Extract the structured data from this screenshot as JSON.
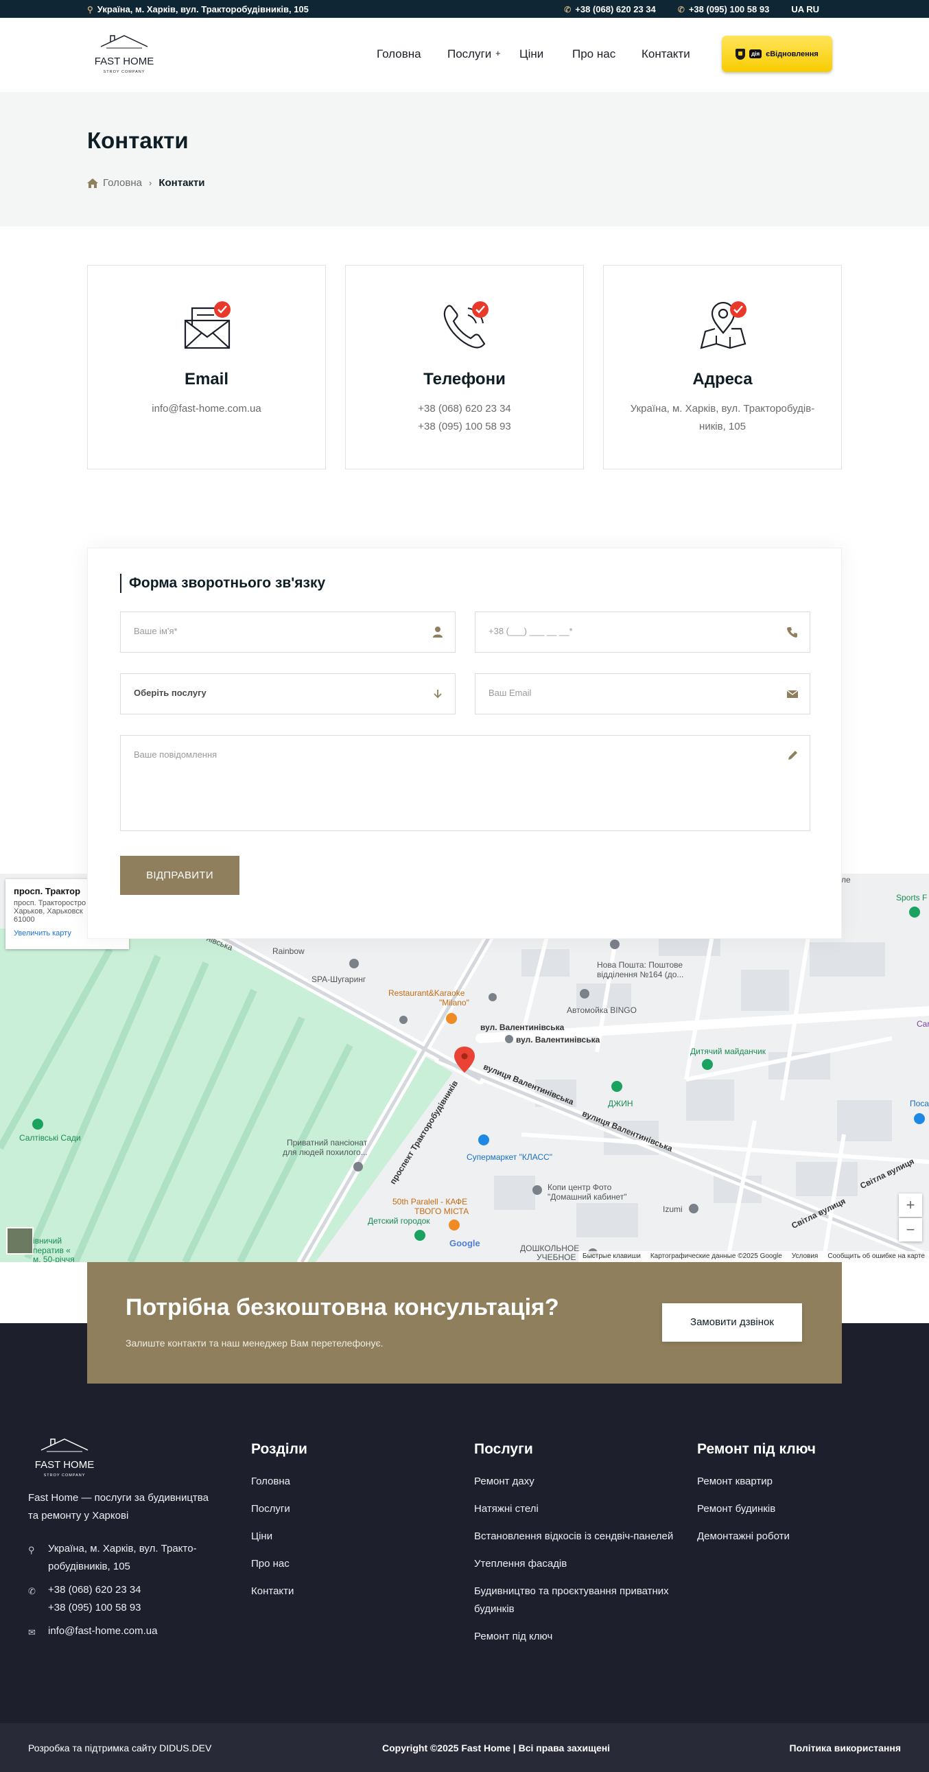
{
  "topbar": {
    "address": "Україна, м. Харків, вул. Тракторобудівників, 105",
    "phone1": "+38 (068) 620 23 34",
    "phone2": "+38 (095) 100 58 93",
    "lang": "UA RU"
  },
  "header": {
    "logo_name": "FAST HOME",
    "logo_sub": "STROY COMPANY",
    "nav": [
      "Головна",
      "Послуги",
      "Ціни",
      "Про нас",
      "Контакти"
    ],
    "nav_plus": "+",
    "diia_badge": "дія",
    "diia_label": "єВідновлення"
  },
  "page": {
    "title": "Контакти",
    "breadcrumb_home": "Головна",
    "breadcrumb_current": "Контакти"
  },
  "cards": [
    {
      "icon": "email-icon",
      "title": "Email",
      "lines": [
        "info@fast-home.com.ua"
      ]
    },
    {
      "icon": "phone-icon",
      "title": "Телефони",
      "lines": [
        "+38 (068) 620 23 34",
        "+38 (095) 100 58 93"
      ]
    },
    {
      "icon": "location-icon",
      "title": "Адреса",
      "lines": [
        "Україна, м. Харків, вул. Тракторобудів-",
        "ників, 105"
      ]
    }
  ],
  "form": {
    "title": "Форма зворотнього зв'язку",
    "name_placeholder": "Ваше ім'я*",
    "phone_placeholder": "+38 (___) ___ __ __*",
    "service_label": "Оберіть послугу",
    "email_placeholder": "Ваш Email",
    "message_placeholder": "Ваше повідомлення",
    "submit": "ВІДПРАВИТИ"
  },
  "map": {
    "info_title": "просп. Трактор",
    "info_lines": [
      "просп. Тракторостро",
      "Харьков, Харьковск",
      "61000"
    ],
    "info_link": "Увеличить карту",
    "labels": {
      "rainbow": "Rainbow",
      "spa": "SPA-Шугаринг",
      "karaoke1": "Restaurant&Karaoke",
      "karaoke2": "\"Milano\"",
      "nova1": "Нова Пошта: Поштове",
      "nova2": "відділення №164 (до...",
      "bingo": "Автомойка BINGO",
      "valent1": "вул. Валентинівська",
      "valent2": "вул. Валентинівська",
      "playground": "Дитячий майданчик",
      "djin": "ДЖИН",
      "saltivski": "Салтівські Сади",
      "pansion1": "Приватний пансіонат",
      "pansion2": "для людей похилого...",
      "market": "Супермаркет \"КЛАСС\"",
      "copy1": "Копи центр Фото",
      "copy2": "\"Домашний кабинет\"",
      "izumi": "Izumi",
      "paralel1": "50th Paralell - КАФЕ",
      "paralel2": "ТВОГО МІСТА",
      "kids": "Детский городок",
      "school1": "ДОШКОЛЬНОЕ",
      "school2": "УЧЕБНОЕ",
      "street1": "вулиця Валентинівська",
      "street2": "вулиця Валентинівська",
      "street3": "проспект Тракторобудівників",
      "svitla1": "Світла вулиця",
      "svitla2": "Світла вулиця",
      "sports": "Sports F",
      "google": "Google",
      "left1": "івничий",
      "left2": "ператив «",
      "left3": "м. 50-річчя",
      "nivska": "нівська",
      "le": "ле",
      "pos": "Поса",
      "car": "Car"
    },
    "footer": [
      "Быстрые клавиши",
      "Картографические данные ©2025 Google",
      "Условия",
      "Сообщить об ошибке на карте"
    ],
    "zoom_in": "+",
    "zoom_out": "−"
  },
  "cta": {
    "title": "Потрібна безкоштовна консультація?",
    "text": "Залиште контакти та наш менеджер Вам перетелефонує.",
    "button": "Замовити дзвінок"
  },
  "footer": {
    "logo_name": "FAST HOME",
    "logo_sub": "STROY COMPANY",
    "about": "Fast Home — послуги за будивництва та ремонту у Харкові",
    "address": "Україна, м. Харків, вул. Трактo-робудівників, 105",
    "phone1": "+38 (068) 620 23 34",
    "phone2": "+38 (095) 100 58 93",
    "email": "info@fast-home.com.ua",
    "col1_title": "Розділи",
    "col1": [
      "Головна",
      "Послуги",
      "Ціни",
      "Про нас",
      "Контакти"
    ],
    "col2_title": "Послуги",
    "col2": [
      "Ремонт даху",
      "Натяжні стелі",
      "Встановлення відкосів із сендвіч-панелей",
      "Утеплення фасадів",
      "Будивництво та проєктування приватних будинків",
      "Ремонт під ключ"
    ],
    "col3_title": "Ремонт під ключ",
    "col3": [
      "Ремонт квартир",
      "Ремонт будинків",
      "Демонтажні роботи"
    ]
  },
  "bottombar": {
    "dev": "Розробка та підтримка сайту DIDUS.DEV",
    "copyright": "Copyright ©2025 Fast Home | Всі права захищені",
    "policy": "Політика використання"
  },
  "colors": {
    "accent": "#8f7f5d",
    "topbar": "#0f2734",
    "footer": "#1d1f2d",
    "badge_red": "#e8392b",
    "diia_yellow": "#f8cc00"
  }
}
